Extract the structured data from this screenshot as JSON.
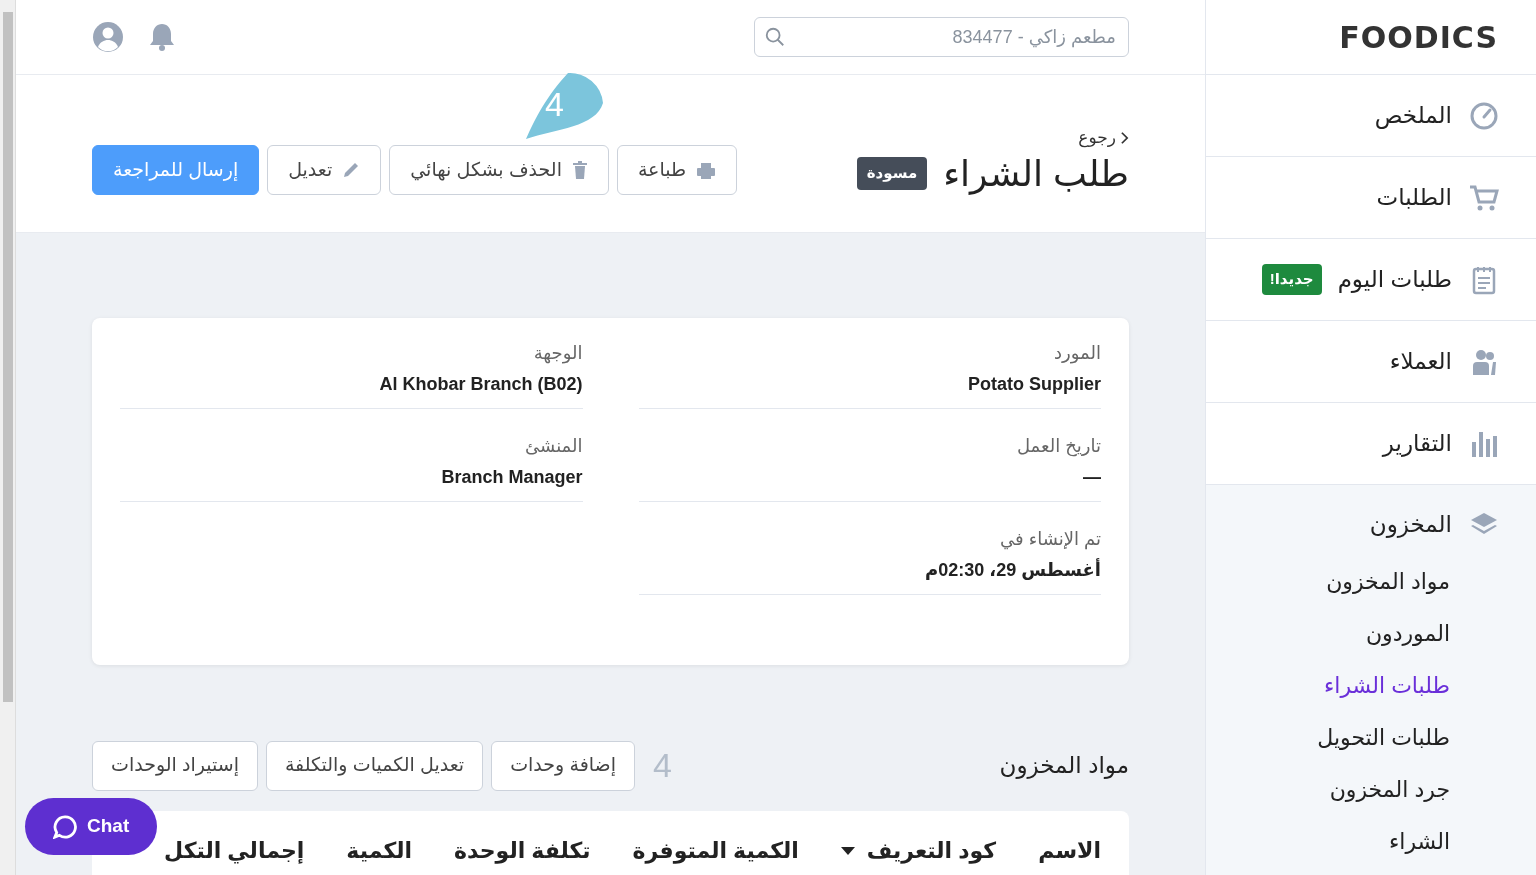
{
  "brand": "FOODICS",
  "search": {
    "placeholder": "مطعم زاكي - 834477"
  },
  "sidebar": {
    "items": [
      {
        "label": "الملخص",
        "selected": false
      },
      {
        "label": "الطلبات",
        "selected": false
      },
      {
        "label": "طلبات اليوم",
        "badge": "جديدا!",
        "selected": false
      },
      {
        "label": "العملاء",
        "selected": false
      },
      {
        "label": "التقارير",
        "selected": false
      },
      {
        "label": "المخزون",
        "selected": false,
        "expanded": true,
        "children": [
          {
            "label": "مواد المخزون",
            "selected": false
          },
          {
            "label": "الموردون",
            "selected": false
          },
          {
            "label": "طلبات الشراء",
            "selected": true
          },
          {
            "label": "طلبات التحويل",
            "selected": false
          },
          {
            "label": "جرد المخزون",
            "selected": false
          },
          {
            "label": "الشراء",
            "selected": false
          }
        ]
      }
    ]
  },
  "header": {
    "back": "رجوع",
    "title": "طلب الشراء",
    "status": "مسودة",
    "buttons": [
      {
        "label": "طباعة",
        "kind": "outline"
      },
      {
        "label": "الحذف بشكل نهائي",
        "kind": "outline"
      },
      {
        "label": "تعديل",
        "kind": "outline"
      },
      {
        "label": "إرسال للمراجعة",
        "kind": "primary"
      }
    ]
  },
  "tour": {
    "bubble": "4",
    "hint": "4"
  },
  "details": [
    {
      "label": "المورد",
      "value": "Potato Supplier"
    },
    {
      "label": "الوجهة",
      "value": "Al Khobar Branch (B02)"
    },
    {
      "label": "تاريخ العمل",
      "value": "—"
    },
    {
      "label": "المنشئ",
      "value": "Branch Manager"
    },
    {
      "label": "تم الإنشاء في",
      "value": "أغسطس 29، 02:30م"
    }
  ],
  "items_section": {
    "title": "مواد المخزون",
    "buttons": [
      "إضافة وحدات",
      "تعديل الكميات والتكلفة",
      "إستيراد الوحدات"
    ],
    "table": {
      "columns": [
        {
          "label": "الاسم",
          "sorted": false
        },
        {
          "label": "كود التعريف",
          "sorted": true
        },
        {
          "label": "الكمية المتوفرة",
          "sorted": false
        },
        {
          "label": "تكلفة الوحدة",
          "sorted": false
        },
        {
          "label": "الكمية",
          "sorted": false
        },
        {
          "label": "إجمالي التكل",
          "sorted": false
        }
      ]
    }
  },
  "chat": {
    "label": "Chat"
  }
}
